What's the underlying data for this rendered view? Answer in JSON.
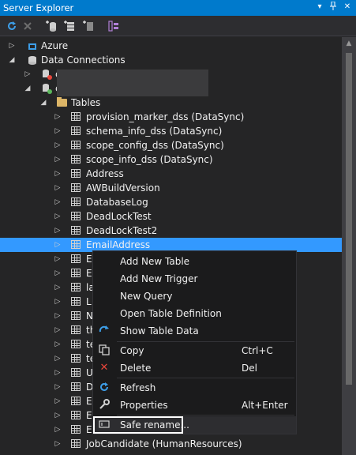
{
  "window": {
    "title": "Server Explorer",
    "pin_icon": "dropdown-arrow-icon",
    "close_icon": "close-icon"
  },
  "toolbar": {
    "items": [
      "refresh-icon",
      "stop-icon",
      "connect-to-database-icon",
      "connect-to-server-icon",
      "connect-to-sharepoint-icon",
      "filter-icon"
    ]
  },
  "tree": {
    "azure": "Azure",
    "data_connections": "Data Connections",
    "connection_1_partial": "c",
    "connection_2_partial": "c",
    "tables_folder": "Tables",
    "tables": [
      "provision_marker_dss (DataSync)",
      "schema_info_dss (DataSync)",
      "scope_config_dss (DataSync)",
      "scope_info_dss (DataSync)",
      "Address",
      "AWBuildVersion",
      "DatabaseLog",
      "DeadLockTest",
      "DeadLockTest2",
      "EmailAddress",
      "E",
      "E",
      "la",
      "L",
      "N",
      "th",
      "te",
      "te",
      "U",
      "D",
      "E",
      "E",
      "E",
      "JobCandidate (HumanResources)"
    ],
    "selected": "EmailAddress"
  },
  "context_menu": {
    "add_new_table": "Add New Table",
    "add_new_trigger": "Add New Trigger",
    "new_query": "New Query",
    "open_table_definition": "Open Table Definition",
    "show_table_data": "Show Table Data",
    "copy": "Copy",
    "copy_shortcut": "Ctrl+C",
    "delete": "Delete",
    "delete_shortcut": "Del",
    "refresh": "Refresh",
    "properties": "Properties",
    "properties_shortcut": "Alt+Enter",
    "safe_rename": "Safe rename..."
  },
  "colors": {
    "accent": "#007acc",
    "selection": "#3399ff",
    "background": "#252526",
    "menu": "#1b1b1c",
    "delete_icon": "#e8463b",
    "refresh_icon": "#3d9ee8"
  }
}
